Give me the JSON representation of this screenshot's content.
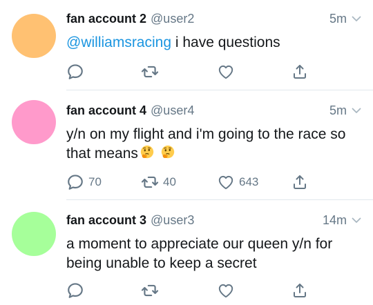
{
  "colors": {
    "text": "#14171a",
    "secondary": "#657786",
    "link": "#1b95e0",
    "divider": "#e1e8ed"
  },
  "tweets": [
    {
      "avatar_color": "#ffc172",
      "name": "fan account 2",
      "handle": "@user2",
      "time": "5m",
      "mention": "@williamsracing",
      "text": " i have questions",
      "replies": "",
      "retweets": "",
      "likes": ""
    },
    {
      "avatar_color": "#ff9acb",
      "name": "fan account 4",
      "handle": "@user4",
      "time": "5m",
      "text": "y/n on my flight and i'm going to the race so that means",
      "emojis": [
        "thinking-face",
        "thinking-face"
      ],
      "replies": "70",
      "retweets": "40",
      "likes": "643"
    },
    {
      "avatar_color": "#a6ff9a",
      "name": "fan account 3",
      "handle": "@user3",
      "time": "14m",
      "text": "a moment to appreciate our queen y/n for being unable to keep a secret",
      "replies": "",
      "retweets": "",
      "likes": ""
    }
  ]
}
